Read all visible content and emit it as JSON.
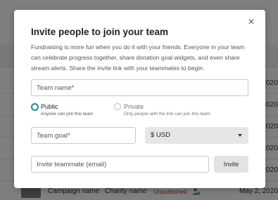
{
  "background": {
    "row_dates": [
      "2020",
      "2020",
      "2020",
      "2020",
      "2020"
    ],
    "bottom_row": {
      "campaign": "Campaign name",
      "charity": "Charity name",
      "status": "Unpublished",
      "date": "May 2, 2020"
    }
  },
  "modal": {
    "title": "Invite people to join your team",
    "description": "Fundraising is more fun when you do it with your friends. Everyone in your team can celebrate progress together, share donation goal widgets, and even share stream alerts. Share the invite link with your teammates to begin.",
    "close_symbol": "✕",
    "team_name_placeholder": "Team name*",
    "visibility": {
      "selected": "public",
      "public_label": "Public",
      "public_sub": "Anyone can join this team",
      "private_label": "Private",
      "private_sub": "Only people with the link can join this team"
    },
    "team_goal_placeholder": "Team goal*",
    "currency": "$ USD",
    "invite_placeholder": "Invite teammate (email)",
    "invite_button": "Invite"
  },
  "colors": {
    "accent": "#1f8f86",
    "overlay": "rgba(0,0,0,0.5)",
    "status_unpublished": "#c0392b"
  },
  "icons": {
    "close": "close-icon",
    "dropdown": "chevron-down-icon",
    "people": "people-icon"
  }
}
